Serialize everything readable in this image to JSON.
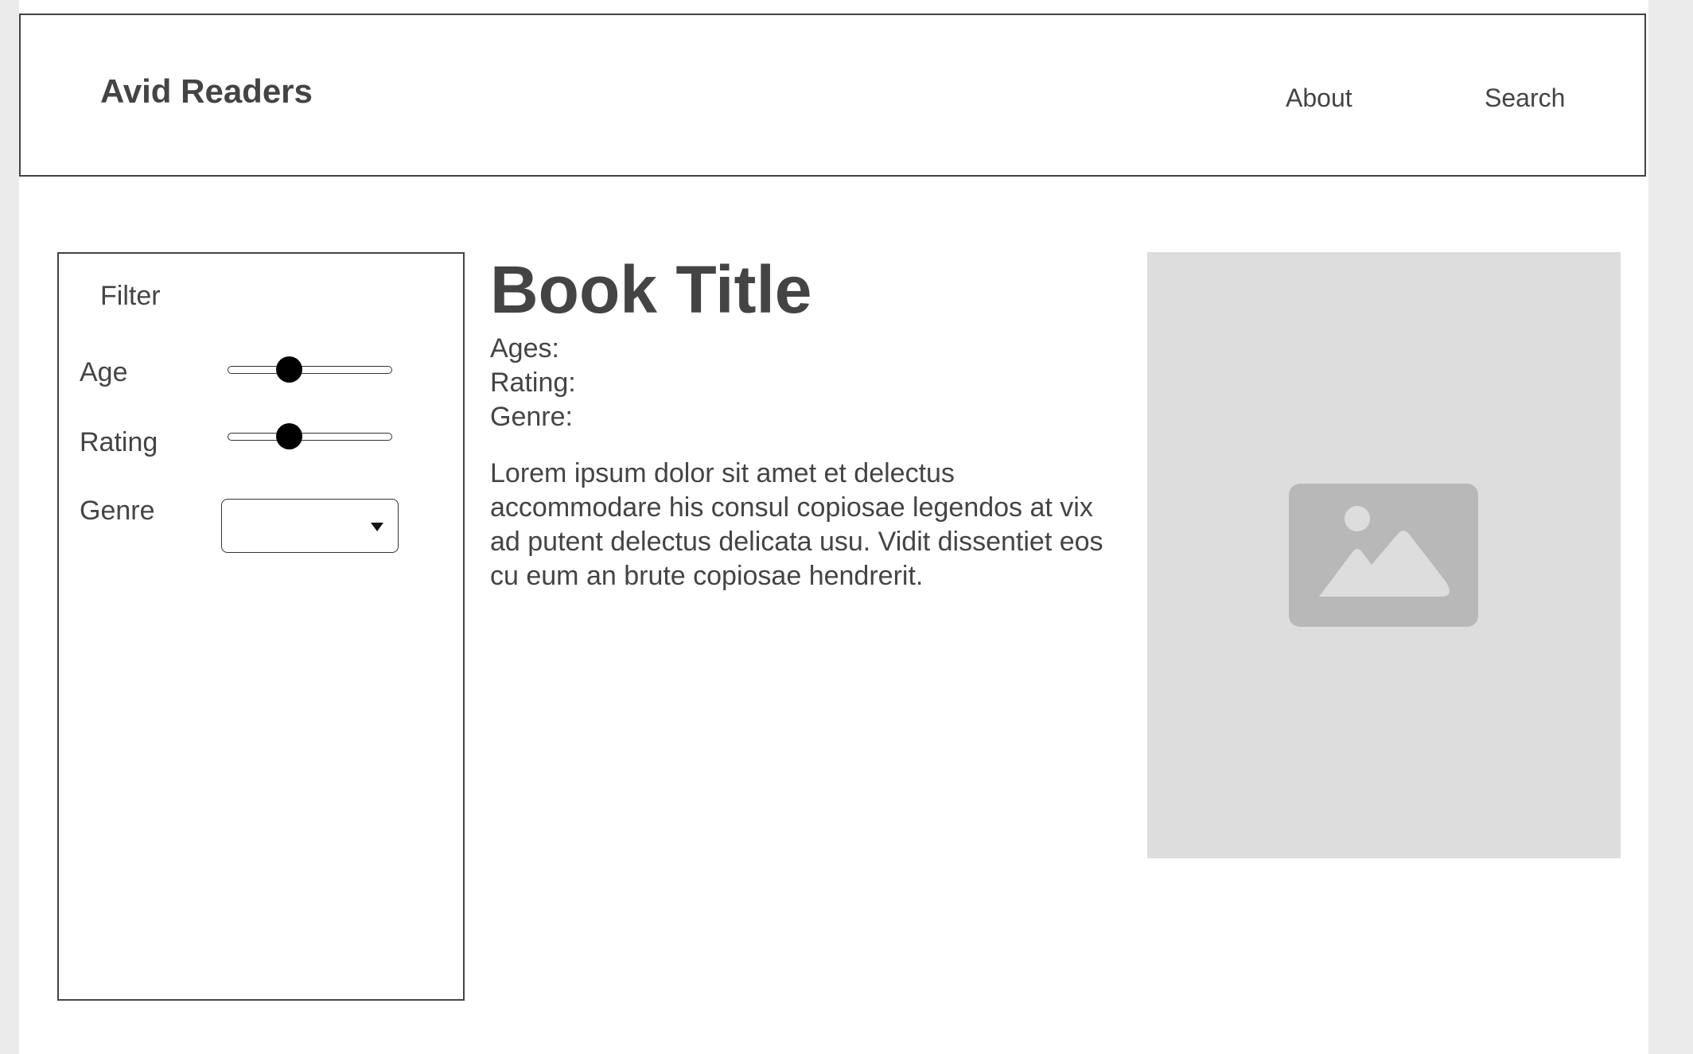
{
  "header": {
    "brand": "Avid Readers",
    "nav": {
      "about": "About",
      "search": "Search"
    }
  },
  "filter": {
    "title": "Filter",
    "age": {
      "label": "Age",
      "value_fraction": 0.37
    },
    "rating": {
      "label": "Rating",
      "value_fraction": 0.37
    },
    "genre": {
      "label": "Genre",
      "selected": ""
    }
  },
  "book": {
    "title": "Book Title",
    "ages_label": "Ages:",
    "rating_label": "Rating:",
    "genre_label": "Genre:",
    "description": "Lorem ipsum dolor sit amet et delectus accommodare his consul copiosae legendos at vix ad putent delectus delicata usu. Vidit dissentiet eos cu eum an brute copiosae hendrerit.",
    "cover_icon": "image-placeholder-icon"
  },
  "colors": {
    "text": "#444444",
    "placeholder_bg": "#dddddd",
    "placeholder_icon": "#b8b8b8"
  }
}
